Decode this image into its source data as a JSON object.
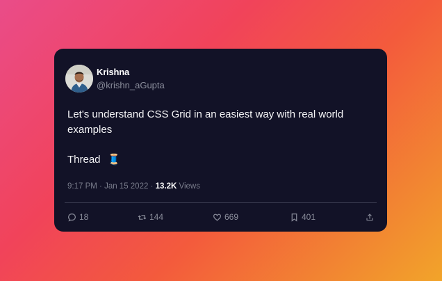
{
  "tweet": {
    "author_name": "Krishna",
    "author_handle": "@krishn_aGupta",
    "text": "Let's understand CSS Grid in an easiest way with real world examples",
    "thread_label": "Thread",
    "thread_emoji": "🧵",
    "time": "9:17 PM",
    "date": "Jan 15 2022",
    "views_count": "13.2K",
    "views_label": "Views"
  },
  "actions": {
    "replies": "18",
    "retweets": "144",
    "likes": "669",
    "bookmarks": "401"
  },
  "icons": {
    "reply": "reply-icon",
    "retweet": "retweet-icon",
    "like": "heart-icon",
    "bookmark": "bookmark-icon",
    "share": "share-icon"
  },
  "colors": {
    "card_bg": "#121227",
    "muted": "#8b8e9c",
    "gradient_start": "#ea4c89",
    "gradient_end": "#f2a42a"
  }
}
